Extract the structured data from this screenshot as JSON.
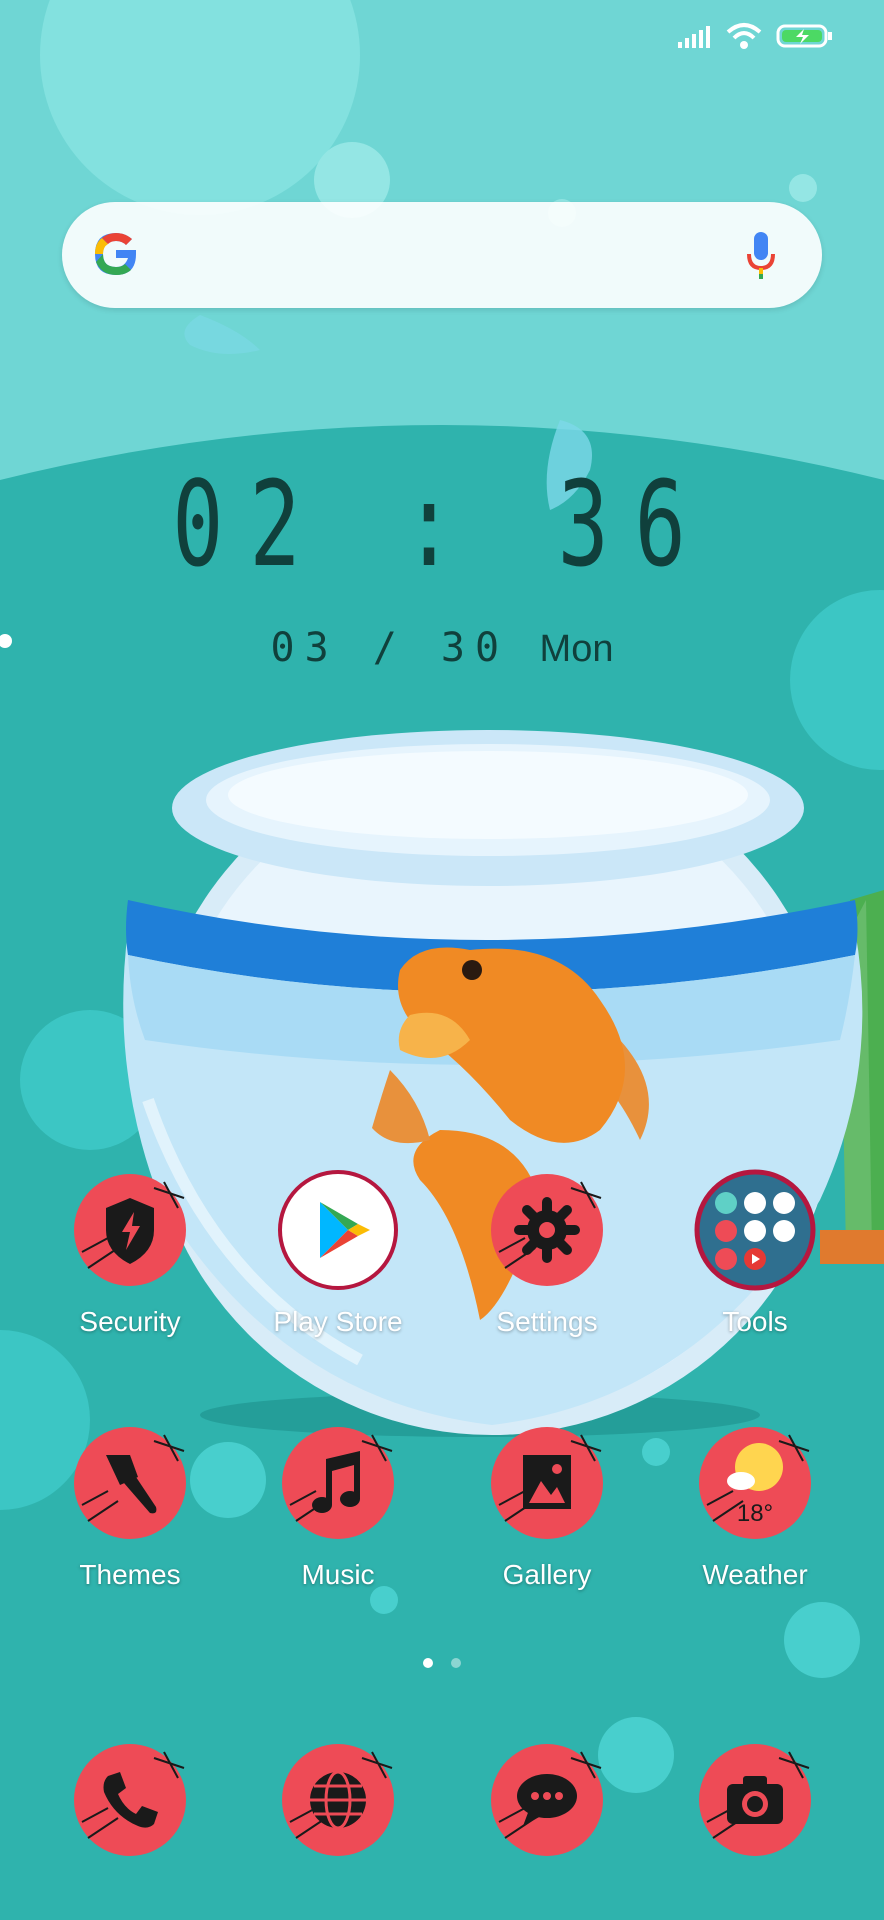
{
  "clock": {
    "time": "02 : 36",
    "date": "03 / 30",
    "weekday": "Mon"
  },
  "search_bar": {
    "logo": "google-logo",
    "mic_icon": "microphone-icon"
  },
  "status_bar": {
    "icons": [
      "signal-icon",
      "wifi-icon",
      "battery-charging-icon"
    ]
  },
  "apps": [
    {
      "label": "Security",
      "icon": "shield-bolt-icon"
    },
    {
      "label": "Play Store",
      "icon": "play-store-icon"
    },
    {
      "label": "Settings",
      "icon": "gear-icon"
    },
    {
      "label": "Tools",
      "icon": "folder-icon"
    },
    {
      "label": "Themes",
      "icon": "paintbrush-icon"
    },
    {
      "label": "Music",
      "icon": "music-note-icon"
    },
    {
      "label": "Gallery",
      "icon": "picture-icon"
    },
    {
      "label": "Weather",
      "icon": "sun-cloud-icon",
      "temperature": "18°"
    }
  ],
  "dock": [
    {
      "icon": "phone-icon"
    },
    {
      "icon": "globe-icon"
    },
    {
      "icon": "chat-bubble-icon"
    },
    {
      "icon": "camera-icon"
    }
  ],
  "page_indicator": {
    "count": 2,
    "active": 1
  },
  "colors": {
    "background": "#2fb3ad",
    "icon_red": "#ee4b56",
    "clock_text": "#10403c",
    "label_text": "#ffffff",
    "fish_orange": "#f08a24"
  }
}
